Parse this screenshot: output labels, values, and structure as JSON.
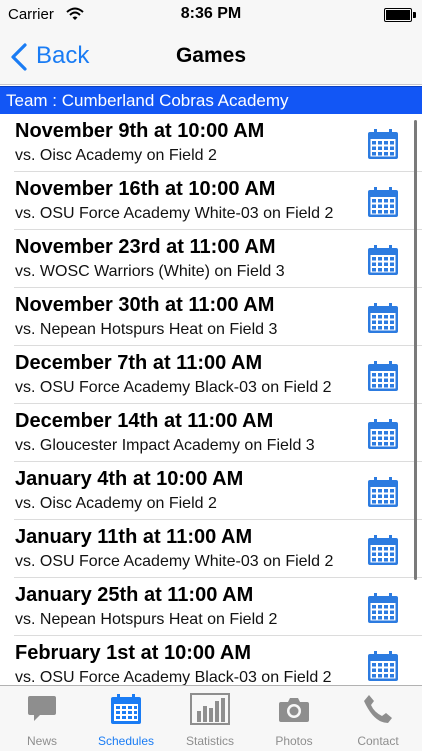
{
  "status_bar": {
    "carrier": "Carrier",
    "time": "8:36 PM"
  },
  "nav_bar": {
    "back_label": "Back",
    "title": "Games"
  },
  "team_header": "Team : Cumberland Cobras Academy",
  "games": [
    {
      "date": "November 9th at 10:00 AM",
      "opponent": "vs. Oisc Academy on Field 2"
    },
    {
      "date": "November 16th at 10:00 AM",
      "opponent": "vs. OSU Force Academy White-03 on Field 2"
    },
    {
      "date": "November 23rd at 11:00 AM",
      "opponent": "vs. WOSC Warriors (White) on Field 3"
    },
    {
      "date": "November 30th at 11:00 AM",
      "opponent": "vs. Nepean Hotspurs Heat on Field 3"
    },
    {
      "date": "December 7th at 11:00 AM",
      "opponent": "vs. OSU Force Academy Black-03 on Field 2"
    },
    {
      "date": "December 14th at 11:00 AM",
      "opponent": "vs. Gloucester Impact Academy on Field 3"
    },
    {
      "date": "January 4th at 10:00 AM",
      "opponent": "vs. Oisc Academy on Field 2"
    },
    {
      "date": "January 11th at 11:00 AM",
      "opponent": "vs. OSU Force Academy White-03 on Field 2"
    },
    {
      "date": "January 25th at 11:00 AM",
      "opponent": "vs. Nepean Hotspurs Heat on Field 2"
    },
    {
      "date": "February 1st at 10:00 AM",
      "opponent": "vs. OSU Force Academy Black-03 on Field 2"
    }
  ],
  "tabs": [
    {
      "label": "News",
      "icon": "speech-bubble-icon",
      "active": false
    },
    {
      "label": "Schedules",
      "icon": "calendar-icon",
      "active": true
    },
    {
      "label": "Statistics",
      "icon": "bar-chart-icon",
      "active": false
    },
    {
      "label": "Photos",
      "icon": "camera-icon",
      "active": false
    },
    {
      "label": "Contact",
      "icon": "phone-icon",
      "active": false
    }
  ],
  "colors": {
    "accent": "#1a7cf4",
    "team_header_bg": "#1256f5",
    "calendar_icon": "#2c7be0",
    "tab_inactive": "#8e8e8e"
  }
}
